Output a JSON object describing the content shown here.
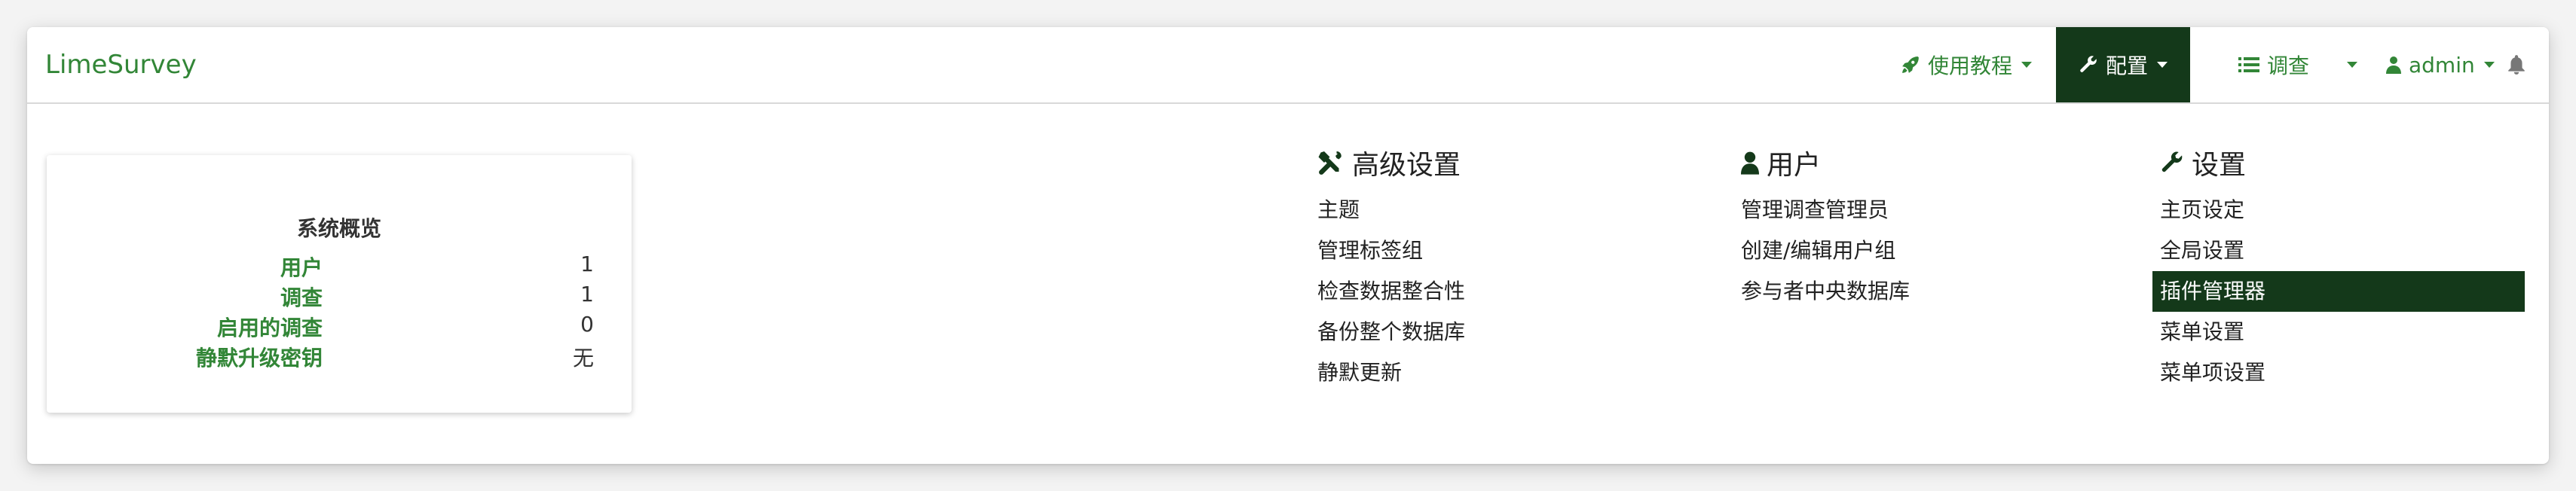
{
  "brand": "LimeSurvey",
  "navbar": {
    "tutorials_label": "使用教程",
    "config_label": "配置",
    "surveys_label": "调查",
    "admin_label": "admin"
  },
  "overview": {
    "title": "系统概览",
    "stats": [
      {
        "label": "用户",
        "value": "1"
      },
      {
        "label": "调查",
        "value": "1"
      },
      {
        "label": "启用的调查",
        "value": "0"
      },
      {
        "label": "静默升级密钥",
        "value": "无"
      }
    ]
  },
  "menus": {
    "advanced": {
      "title": "高级设置",
      "items": [
        "主题",
        "管理标签组",
        "检查数据整合性",
        "备份整个数据库",
        "静默更新"
      ]
    },
    "users": {
      "title": "用户",
      "items": [
        "管理调查管理员",
        "创建/编辑用户组",
        "参与者中央数据库"
      ]
    },
    "settings": {
      "title": "设置",
      "items": [
        "主页设定",
        "全局设置",
        "插件管理器",
        "菜单设置",
        "菜单项设置"
      ],
      "active_index": 2
    }
  },
  "colors": {
    "accent": "#328637",
    "dark_active": "#14391a"
  }
}
